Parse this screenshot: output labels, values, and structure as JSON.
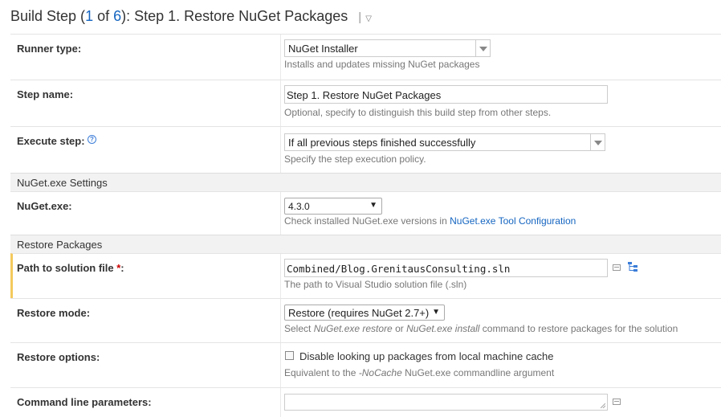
{
  "header": {
    "prefix": "Build Step (",
    "current": "1",
    "of_text": " of ",
    "total": "6",
    "suffix": "): Step 1. Restore NuGet Packages",
    "divider": "|",
    "menu_arrow": "▽"
  },
  "runner_type": {
    "label": "Runner type:",
    "value": "NuGet Installer",
    "note": "Installs and updates missing NuGet packages"
  },
  "step_name": {
    "label": "Step name:",
    "value": "Step 1. Restore NuGet Packages",
    "note": "Optional, specify to distinguish this build step from other steps."
  },
  "execute_step": {
    "label": "Execute step:",
    "help_icon": "?",
    "value": "If all previous steps finished successfully",
    "note": "Specify the step execution policy."
  },
  "section_nuget": {
    "title": "NuGet.exe Settings"
  },
  "nuget_exe": {
    "label": "NuGet.exe:",
    "value": "4.3.0",
    "note_prefix": "Check installed NuGet.exe versions in ",
    "note_link": "NuGet.exe Tool Configuration"
  },
  "section_restore": {
    "title": "Restore Packages"
  },
  "solution_path": {
    "label": "Path to solution file ",
    "required": "*",
    "colon": ":",
    "value": "Combined/Blog.GrenitausConsulting.sln",
    "note": "The path to Visual Studio solution file (.sln)"
  },
  "restore_mode": {
    "label": "Restore mode:",
    "value": "Restore (requires NuGet 2.7+)",
    "note_a": "Select ",
    "note_b": "NuGet.exe restore",
    "note_c": " or ",
    "note_d": "NuGet.exe install",
    "note_e": " command to restore packages for the solution"
  },
  "restore_options": {
    "label": "Restore options:",
    "checkbox_label": "Disable looking up packages from local machine cache",
    "checked": false,
    "note_a": "Equivalent to the ",
    "note_b": "-NoCache",
    "note_c": " NuGet.exe commandline argument"
  },
  "command_line": {
    "label": "Command line parameters:",
    "value": ""
  },
  "arrows": {
    "native": "▼"
  },
  "icons": {
    "help": "help-icon",
    "text_editor": "text-editor-icon",
    "tree": "tree-browse-icon"
  },
  "colors": {
    "link": "#1565c0",
    "required": "#cc0000",
    "highlight": "#f4c95d"
  }
}
